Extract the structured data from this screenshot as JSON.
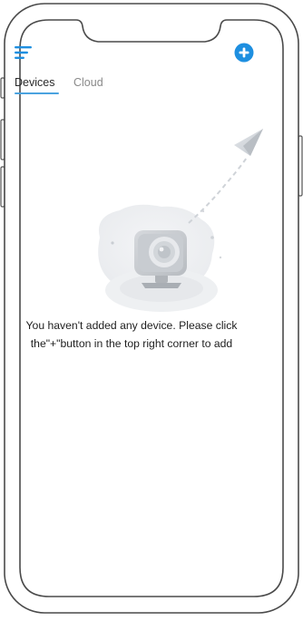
{
  "header": {
    "menu_icon": "hamburger-menu-icon",
    "add_icon": "plus-circle-icon",
    "accent_color": "#1e8fe0"
  },
  "tabs": [
    {
      "label": "Devices",
      "selected": true
    },
    {
      "label": "Cloud",
      "selected": false
    }
  ],
  "empty_state": {
    "illustration_icon": "camera-with-paper-plane-icon",
    "message_line1": "You haven't added any device. Please click",
    "message_line2": "the\"+\"button in the top right corner to add"
  }
}
